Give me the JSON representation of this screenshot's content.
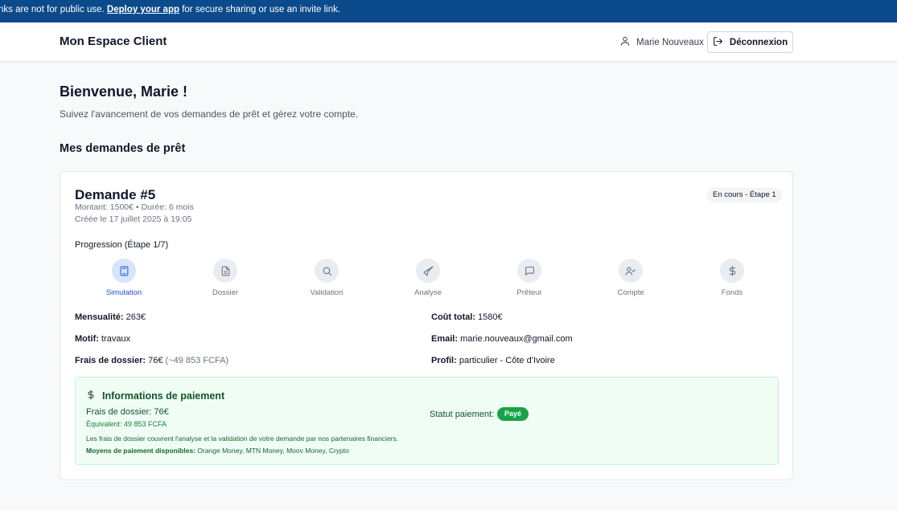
{
  "banner": {
    "text_before": "nks are not for public use. ",
    "link": "Deploy your app",
    "text_after": " for secure sharing or use an invite link."
  },
  "header": {
    "title": "Mon Espace Client",
    "user_name": "Marie Nouveaux",
    "logout_label": "Déconnexion"
  },
  "welcome": {
    "title": "Bienvenue, Marie !",
    "subtitle": "Suivez l'avancement de vos demandes de prêt et gérez votre compte."
  },
  "section_title": "Mes demandes de prêt",
  "request": {
    "title": "Demande #5",
    "meta": "Montant: 1500€ • Durée: 6 mois",
    "created": "Créée le 17 juillet 2025 à 19:05",
    "status": "En cours - Étape 1",
    "progress_label": "Progression (Étape 1/7)",
    "steps": [
      {
        "label": "Simulation",
        "icon": "calculator-icon",
        "active": true
      },
      {
        "label": "Dossier",
        "icon": "document-icon",
        "active": false
      },
      {
        "label": "Validation",
        "icon": "search-icon",
        "active": false
      },
      {
        "label": "Analyse",
        "icon": "send-icon",
        "active": false
      },
      {
        "label": "Prêteur",
        "icon": "message-icon",
        "active": false
      },
      {
        "label": "Compte",
        "icon": "user-check-icon",
        "active": false
      },
      {
        "label": "Fonds",
        "icon": "dollar-icon",
        "active": false
      }
    ],
    "fields": {
      "mensualite_label": "Mensualité:",
      "mensualite_value": "263€",
      "cout_label": "Coût total:",
      "cout_value": "1580€",
      "motif_label": "Motif:",
      "motif_value": "travaux",
      "email_label": "Email:",
      "email_value": "marie.nouveaux@gmail.com",
      "frais_label": "Frais de dossier:",
      "frais_value": "76€",
      "frais_fcfa": "(~49 853 FCFA)",
      "profil_label": "Profil:",
      "profil_value": "particulier - Côte d'Ivoire"
    },
    "payment": {
      "title": "Informations de paiement",
      "fee": "Frais de dossier: 76€",
      "equivalent": "Équivalent: 49 853 FCFA",
      "note": "Les frais de dossier couvrent l'analyse et la validation de votre demande par nos partenaires financiers.",
      "methods_label": "Moyens de paiement disponibles:",
      "methods_value": " Orange Money, MTN Money, Moov Money, Crypto",
      "status_label": "Statut paiement:",
      "status_value": "Payé"
    }
  },
  "colors": {
    "banner": "#0b4a8b",
    "active_step": "#1d4ed8",
    "paid": "#16a34a",
    "payment_bg": "#f0fdf4"
  }
}
